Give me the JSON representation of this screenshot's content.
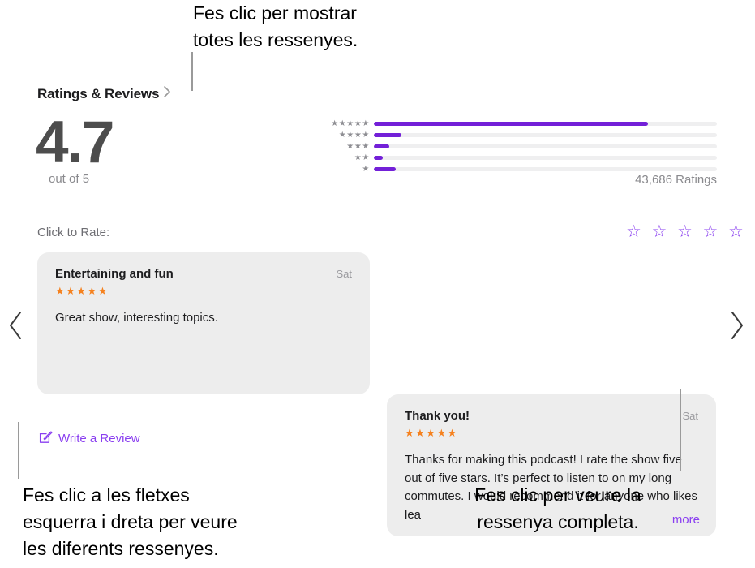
{
  "callouts": {
    "top": "Fes clic per mostrar\ntotes les ressenyes.",
    "bottom_left": "Fes clic a les fletxes\nesquerra i dreta per veure\nles diferents ressenyes.",
    "bottom_right": "Fes clic per veure la\nressenya completa."
  },
  "section": {
    "title": "Ratings & Reviews",
    "chevron_icon": "chevron-right-icon"
  },
  "summary": {
    "score": "4.7",
    "out_of": "out of 5",
    "ratings_count": "43,686 Ratings"
  },
  "histogram": {
    "rows": [
      {
        "stars": "★★★★★",
        "star_count": 5,
        "percent": 80.0
      },
      {
        "stars": "★★★★",
        "star_count": 4,
        "percent": 8.0
      },
      {
        "stars": "★★★",
        "star_count": 3,
        "percent": 4.5
      },
      {
        "stars": "★★",
        "star_count": 2,
        "percent": 2.5
      },
      {
        "stars": "★",
        "star_count": 1,
        "percent": 6.5
      }
    ],
    "bar_color": "#7320d8",
    "track_color": "#efeff0"
  },
  "rate": {
    "label": "Click to Rate:",
    "stars": "☆ ☆ ☆ ☆ ☆",
    "star_color": "#8a3ff0"
  },
  "reviews": [
    {
      "title": "Entertaining and fun",
      "date": "Sat",
      "stars": "★★★★★",
      "rating": 5,
      "body": "Great show, interesting topics.",
      "truncated": false,
      "more_label": ""
    },
    {
      "title": "Thank you!",
      "date": "Sat",
      "stars": "★★★★★",
      "rating": 5,
      "body": "Thanks for making this podcast! I rate the show five out of five stars. It’s perfect to listen to on my long commutes. I would recommend it for anyone who likes lea",
      "truncated": true,
      "more_label": "more"
    }
  ],
  "write_review": {
    "label": "Write a Review",
    "icon": "compose-icon",
    "color": "#8a3ff0"
  },
  "nav": {
    "prev_icon": "chevron-left-icon",
    "next_icon": "chevron-right-icon"
  }
}
